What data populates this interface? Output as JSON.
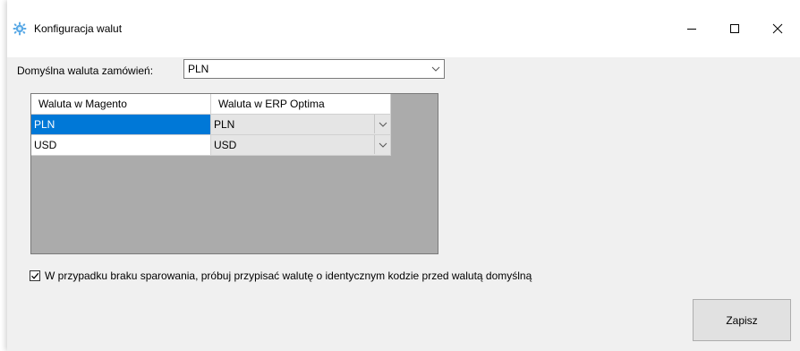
{
  "window": {
    "title": "Konfiguracja walut",
    "icon": "gear-blue-icon"
  },
  "default_currency": {
    "label": "Domyślna waluta zamówień:",
    "value": "PLN"
  },
  "grid": {
    "headers": [
      "Waluta w Magento",
      "Waluta w ERP Optima"
    ],
    "rows": [
      {
        "magento": "PLN",
        "erp": "PLN",
        "selected": true
      },
      {
        "magento": "USD",
        "erp": "USD",
        "selected": false
      }
    ],
    "background_color": "#ababab",
    "selection_color": "#0078d7"
  },
  "fallback_option": {
    "label": "W przypadku braku sparowania, próbuj przypisać walutę o identycznym kodzie przed walutą domyślną",
    "checked": true
  },
  "buttons": {
    "save_label": "Zapisz"
  }
}
